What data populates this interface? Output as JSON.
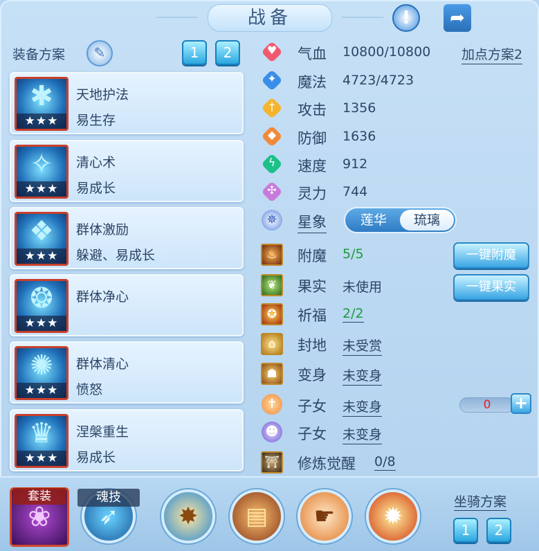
{
  "title": "战备",
  "header": {
    "alert_icon": "exclamation-icon",
    "share_icon": "share-icon",
    "alert_glyph": "!",
    "share_glyph": "➦"
  },
  "equip": {
    "label": "装备方案",
    "scheme_buttons": [
      "1",
      "2"
    ]
  },
  "skills": [
    {
      "name": "天地护法",
      "desc": "易生存",
      "stars": "★★★",
      "glyph": "✱"
    },
    {
      "name": "清心术",
      "desc": "易成长",
      "stars": "★★★",
      "glyph": "✧"
    },
    {
      "name": "群体激励",
      "desc": "躲避、易成长",
      "stars": "★★★",
      "glyph": "❖"
    },
    {
      "name": "群体净心",
      "desc": "",
      "stars": "★★★",
      "glyph": "❂"
    },
    {
      "name": "群体清心",
      "desc": "愤怒",
      "stars": "★★★",
      "glyph": "✺"
    },
    {
      "name": "涅槃重生",
      "desc": "易成长",
      "stars": "★★★",
      "glyph": "♛"
    }
  ],
  "points_scheme": "加点方案2",
  "stats": [
    {
      "name": "气血",
      "value": "10800/10800",
      "color": "#f05a6e",
      "glyph": "♥"
    },
    {
      "name": "魔法",
      "value": "4723/4723",
      "color": "#3a8ee8",
      "glyph": "✦"
    },
    {
      "name": "攻击",
      "value": "1356",
      "color": "#f5b42c",
      "glyph": "†"
    },
    {
      "name": "防御",
      "value": "1636",
      "color": "#f08a3a",
      "glyph": "◆"
    },
    {
      "name": "速度",
      "value": "912",
      "color": "#1cc08a",
      "glyph": "ϟ"
    },
    {
      "name": "灵力",
      "value": "744",
      "color": "#c87adc",
      "glyph": "✣"
    }
  ],
  "star_sign": {
    "label": "星象",
    "options": [
      "莲华",
      "琉璃"
    ],
    "selected": "琉璃",
    "glyph": "✵"
  },
  "extras": [
    {
      "name": "附魔",
      "value": "5/5",
      "glyph": "♨"
    },
    {
      "name": "果实",
      "value": "未使用",
      "glyph": "❦"
    },
    {
      "name": "祈福",
      "value": "2/2",
      "glyph": "✪"
    },
    {
      "name": "封地",
      "value": "未受赏",
      "glyph": "⌂"
    },
    {
      "name": "变身",
      "value": "未变身",
      "glyph": "☗"
    },
    {
      "name": "子女",
      "value": "未变身",
      "glyph": "✝"
    },
    {
      "name": "子女",
      "value": "未变身",
      "glyph": "☻"
    },
    {
      "name": "修炼觉醒",
      "value": "0/8",
      "glyph": "⛩"
    }
  ],
  "buttons": {
    "one_key_enchant": "一键附魔",
    "one_key_fruit": "一键果实",
    "plus": "+"
  },
  "child_count": "0",
  "bottom": {
    "suit_label": "套装",
    "soul_label": "魂技",
    "mount_label": "坐骑方案",
    "mount_buttons": [
      "1",
      "2"
    ],
    "suit_glyph": "❀",
    "icons": [
      {
        "name": "soul-skill-icon",
        "glyph": "➶"
      },
      {
        "name": "figure-icon",
        "glyph": "✸"
      },
      {
        "name": "scroll-icon",
        "glyph": "▤"
      },
      {
        "name": "hand-icon",
        "glyph": "☛"
      },
      {
        "name": "burst-icon",
        "glyph": "✹"
      }
    ]
  }
}
